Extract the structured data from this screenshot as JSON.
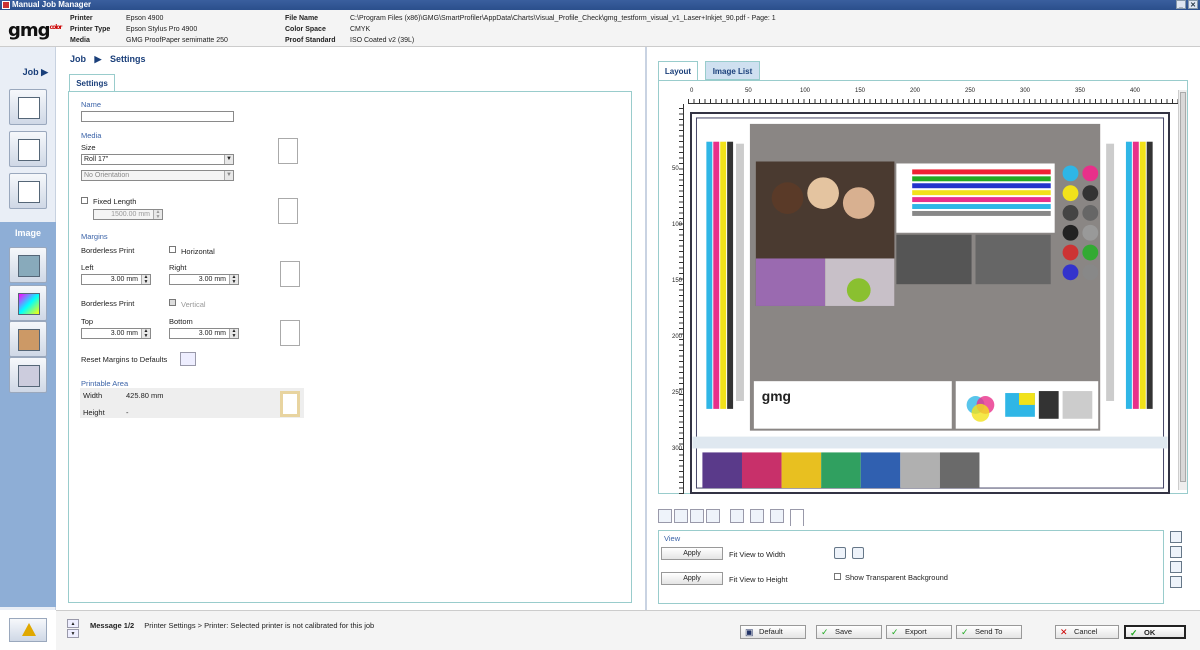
{
  "window": {
    "title": "Manual Job Manager"
  },
  "header": {
    "logo": "gmg",
    "printer_label": "Printer",
    "printer_value": "Epson 4900",
    "printer_type_label": "Printer Type",
    "printer_type_value": "Epson Stylus Pro 4900",
    "media_label": "Media",
    "media_value": "GMG ProofPaper semimatte 250",
    "file_name_label": "File Name",
    "file_name_value": "C:\\Program Files (x86)\\GMG\\SmartProfiler\\AppData\\Charts\\Visual_Profile_Check\\gmg_testform_visual_v1_Laser+Inkjet_90.pdf - Page: 1",
    "color_space_label": "Color Space",
    "color_space_value": "CMYK",
    "proof_standard_label": "Proof Standard",
    "proof_standard_value": "ISO Coated v2 (39L)"
  },
  "sidebar": {
    "job": "Job",
    "image": "Image"
  },
  "breadcrumb": {
    "job": "Job",
    "arrow": "▶",
    "settings": "Settings"
  },
  "settings": {
    "tab": "Settings",
    "name_label": "Name",
    "name_value": "",
    "media_section": "Media",
    "size_label": "Size",
    "size_value": "Roll 17\"",
    "orientation_value": "No Orientation",
    "fixed_length_label": "Fixed Length",
    "fixed_length_value": "1500.00 mm",
    "margins_section": "Margins",
    "borderless_print_label": "Borderless Print",
    "horizontal_label": "Horizontal",
    "left_label": "Left",
    "left_value": "3.00 mm",
    "right_label": "Right",
    "right_value": "3.00 mm",
    "borderless_print_label_2": "Borderless Print",
    "vertical_label": "Vertical",
    "top_label": "Top",
    "top_value": "3.00 mm",
    "bottom_label": "Bottom",
    "bottom_value": "3.00 mm",
    "reset_label": "Reset Margins to Defaults",
    "printable_section": "Printable Area",
    "width_label": "Width",
    "width_value": "425.80 mm",
    "height_label": "Height",
    "height_value": "-"
  },
  "right": {
    "tab_layout": "Layout",
    "tab_image_list": "Image List",
    "ruler_h": [
      "0",
      "50",
      "100",
      "150",
      "200",
      "250",
      "300",
      "350",
      "400"
    ],
    "ruler_v": [
      "50",
      "100",
      "150",
      "200",
      "250",
      "300"
    ],
    "view_label": "View",
    "apply_1": "Apply",
    "fit_width": "Fit View to Width",
    "apply_2": "Apply",
    "fit_height": "Fit View to Height",
    "show_transparent": "Show Transparent Background"
  },
  "footer": {
    "message_label": "Message 1/2",
    "message_text": "Printer Settings > Printer: Selected printer is not calibrated for this job",
    "default": "Default",
    "save": "Save",
    "export": "Export",
    "send_to": "Send To",
    "cancel": "Cancel",
    "ok": "OK"
  }
}
